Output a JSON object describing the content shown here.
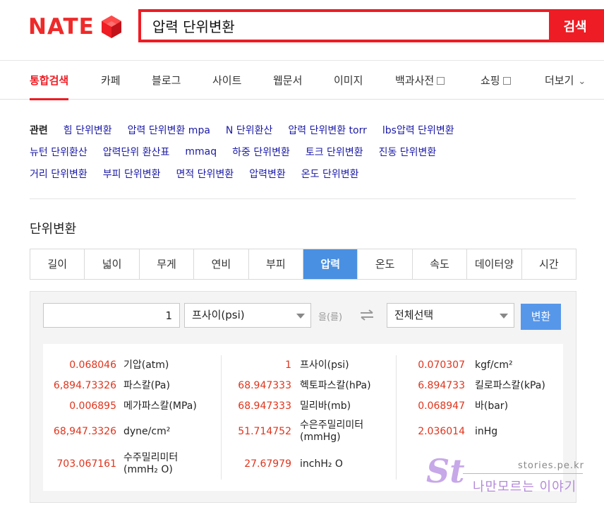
{
  "header": {
    "logo_text": "NATE",
    "search_value": "압력 단위변환",
    "search_button": "검색"
  },
  "nav": {
    "tabs": [
      {
        "label": "통합검색",
        "active": true
      },
      {
        "label": "카페"
      },
      {
        "label": "블로그"
      },
      {
        "label": "사이트"
      },
      {
        "label": "웹문서"
      },
      {
        "label": "이미지"
      },
      {
        "label": "백과사전"
      },
      {
        "label": "쇼핑"
      },
      {
        "label": "더보기"
      }
    ]
  },
  "related": {
    "label": "관련",
    "rows": [
      [
        "힘 단위변환",
        "압력 단위변환 mpa",
        "N 단위환산",
        "압력 단위변환 torr",
        "lbs압력 단위변환"
      ],
      [
        "뉴턴 단위환산",
        "압력단위 환산표",
        "mmaq",
        "하중 단위변환",
        "토크 단위변환",
        "진동 단위변환"
      ],
      [
        "거리 단위변환",
        "부피 단위변환",
        "면적 단위변환",
        "압력변환",
        "온도 단위변환"
      ]
    ]
  },
  "unit": {
    "title": "단위변환",
    "tabs": [
      "길이",
      "넓이",
      "무게",
      "연비",
      "부피",
      "압력",
      "온도",
      "속도",
      "데이터양",
      "시간"
    ],
    "active_tab": "압력",
    "input_value": "1",
    "from_unit": "프사이(psi)",
    "eul_text": "을(를)",
    "to_unit": "전체선택",
    "convert_button": "변환",
    "results": [
      [
        {
          "value": "0.068046",
          "unit": "기압(atm)"
        },
        {
          "value": "6,894.73326",
          "unit": "파스칼(Pa)"
        },
        {
          "value": "0.006895",
          "unit": "메가파스칼(MPa)"
        },
        {
          "value": "68,947.3326",
          "unit": "dyne/cm²"
        },
        {
          "value": "703.067161",
          "unit": "수주밀리미터",
          "unit2": "(mmH₂ O)"
        }
      ],
      [
        {
          "value": "1",
          "unit": "프사이(psi)"
        },
        {
          "value": "68.947333",
          "unit": "헥토파스칼(hPa)"
        },
        {
          "value": "68.947333",
          "unit": "밀리바(mb)"
        },
        {
          "value": "51.714752",
          "unit": "수은주밀리미터",
          "unit2": "(mmHg)"
        },
        {
          "value": "27.67979",
          "unit": "inchH₂ O"
        }
      ],
      [
        {
          "value": "0.070307",
          "unit": "kgf/cm²"
        },
        {
          "value": "6.894733",
          "unit": "킬로파스칼(kPa)"
        },
        {
          "value": "0.068947",
          "unit": "바(bar)"
        },
        {
          "value": "2.036014",
          "unit": "inHg"
        }
      ]
    ]
  },
  "watermark": {
    "letter": "St",
    "url": "stories.pe.kr",
    "text": "나만모르는 이야기"
  },
  "colors": {
    "brand_red": "#ee1c24",
    "active_blue": "#4a90e2",
    "value_red": "#e0341c",
    "link_blue": "#1b1aa6"
  }
}
